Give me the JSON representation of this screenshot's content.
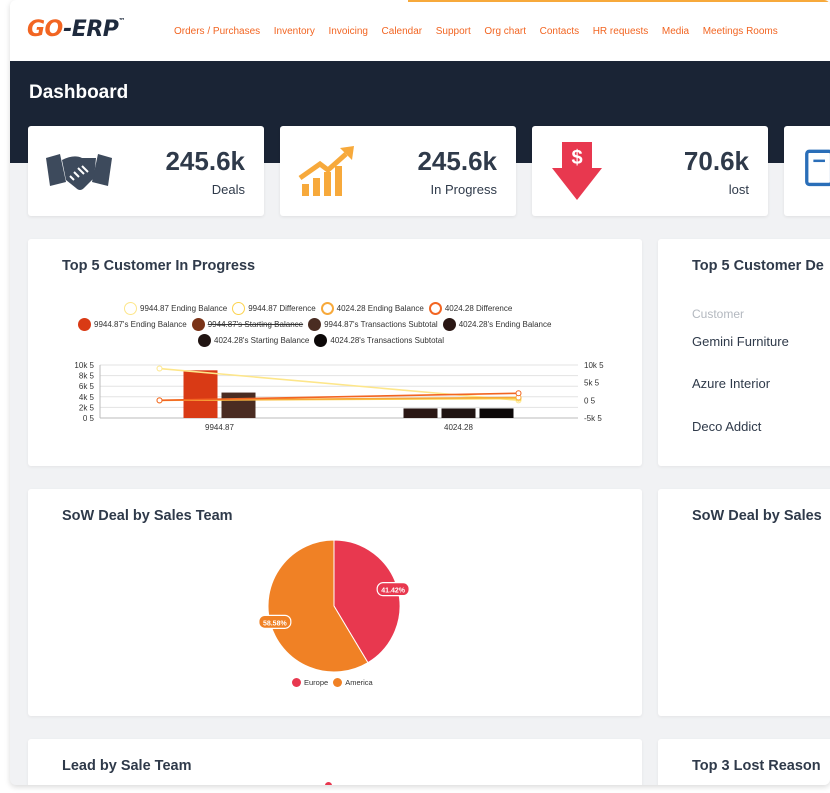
{
  "brand": {
    "go": "GO",
    "erp": "-ERP",
    "tm": "™"
  },
  "nav": [
    "Orders / Purchases",
    "Inventory",
    "Invoicing",
    "Calendar",
    "Support",
    "Org chart",
    "Contacts",
    "HR requests",
    "Media",
    "Meetings Rooms"
  ],
  "page_title": "Dashboard",
  "stats": [
    {
      "value": "245.6k",
      "label": "Deals",
      "icon": "handshake-icon"
    },
    {
      "value": "245.6k",
      "label": "In Progress",
      "icon": "growth-chart-icon"
    },
    {
      "value": "70.6k",
      "label": "lost",
      "icon": "dollar-down-arrow-icon"
    },
    {
      "value": "",
      "label": "",
      "icon": "document-icon"
    }
  ],
  "colors": {
    "accent": "#f26522",
    "header_bg": "#1a2435",
    "europe": "#e8384f",
    "america": "#f08125"
  },
  "top5_progress": {
    "title": "Top 5 Customer In Progress",
    "legend_row1": [
      "9944.87 Ending Balance",
      "9944.87 Difference",
      "4024.28 Ending Balance",
      "4024.28 Difference"
    ],
    "legend_row2": [
      "9944.87's Ending Balance",
      "9944.87's Starting Balance",
      "9944.87's Transactions Subtotal",
      "4024.28's Ending Balance"
    ],
    "legend_row3": [
      "4024.28's Starting Balance",
      "4024.28's Transactions Subtotal"
    ],
    "left_ticks": [
      "10k 5",
      "8k 5",
      "6k 5",
      "4k 5",
      "2k 5",
      "0 5"
    ],
    "right_ticks": [
      "10k 5",
      "5k 5",
      "0 5",
      "-5k 5"
    ],
    "x_labels": [
      "9944.87",
      "4024.28"
    ]
  },
  "chart_data": [
    {
      "type": "bar",
      "categories": [
        "9944.87",
        "4024.28"
      ],
      "series": [
        {
          "name": "9944.87's Ending Balance",
          "values": [
            9000,
            0
          ]
        },
        {
          "name": "9944.87's Transactions Subtotal",
          "values": [
            4800,
            0
          ]
        },
        {
          "name": "4024.28's Ending Balance",
          "values": [
            0,
            1800
          ]
        },
        {
          "name": "4024.28's Starting Balance",
          "values": [
            0,
            1800
          ]
        },
        {
          "name": "4024.28's Transactions Subtotal",
          "values": [
            0,
            1800
          ]
        }
      ],
      "line_series": [
        {
          "name": "9944.87 Ending Balance",
          "values": [
            9000,
            0
          ]
        },
        {
          "name": "9944.87 Difference",
          "values": [
            0,
            500
          ]
        },
        {
          "name": "4024.28 Ending Balance",
          "values": [
            0,
            800
          ]
        },
        {
          "name": "4024.28 Difference",
          "values": [
            0,
            2000
          ]
        }
      ],
      "ylim": [
        0,
        10000
      ],
      "y2lim": [
        -5000,
        10000
      ]
    },
    {
      "type": "pie",
      "title": "SoW Deal by Sales Team",
      "labels": [
        "Europe",
        "America"
      ],
      "values": [
        41.42,
        58.58
      ],
      "value_labels": [
        "41.42%",
        "58.58%"
      ],
      "colors": [
        "#e8384f",
        "#f08125"
      ]
    }
  ],
  "top5_deals": {
    "title": "Top 5 Customer De",
    "column": "Customer",
    "rows": [
      "Gemini Furniture",
      "Azure Interior",
      "Deco Addict"
    ]
  },
  "sow_left_title": "SoW Deal by Sales Team",
  "sow_right_title": "SoW Deal by Sales",
  "lead_title": "Lead by Sale Team",
  "lost_title": "Top 3 Lost Reason"
}
